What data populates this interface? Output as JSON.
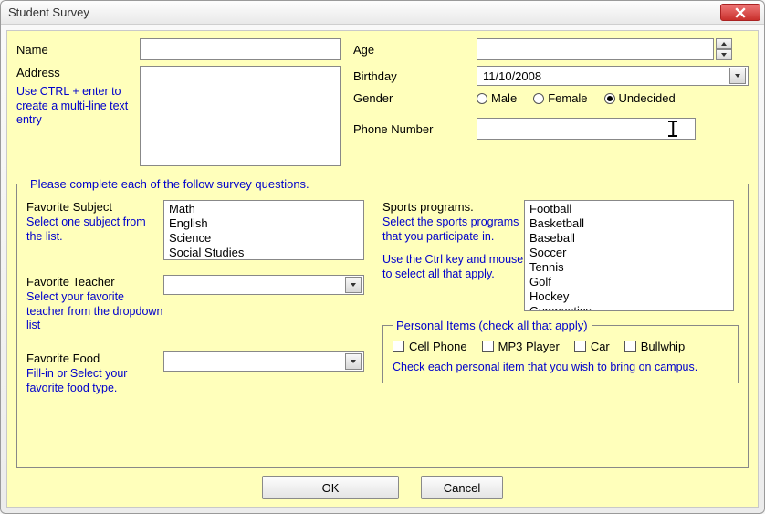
{
  "window": {
    "title": "Student Survey"
  },
  "top": {
    "name_label": "Name",
    "name_value": "",
    "address_label": "Address",
    "address_value": "",
    "address_hint": "Use CTRL + enter to create a multi-line text entry",
    "age_label": "Age",
    "age_value": "",
    "birthday_label": "Birthday",
    "birthday_value": "11/10/2008",
    "gender_label": "Gender",
    "gender_options": {
      "male": "Male",
      "female": "Female",
      "undecided": "Undecided"
    },
    "gender_selected": "undecided",
    "phone_label": "Phone Number",
    "phone_value": ""
  },
  "legend": "Please complete each of the follow survey questions.",
  "subject": {
    "label": "Favorite Subject",
    "hint": "Select one subject from the list.",
    "items": [
      "Math",
      "English",
      "Science",
      "Social Studies"
    ]
  },
  "teacher": {
    "label": "Favorite Teacher",
    "hint": "Select your favorite teacher from the dropdown list",
    "value": ""
  },
  "food": {
    "label": "Favorite Food",
    "hint": "Fill-in or Select your favorite food type.",
    "value": ""
  },
  "sports": {
    "label": "Sports programs.",
    "hint1": "Select the sports programs that you participate in.",
    "hint2": "Use the Ctrl key and mouse to select all that apply.",
    "items": [
      "Football",
      "Basketball",
      "Baseball",
      "Soccer",
      "Tennis",
      "Golf",
      "Hockey",
      "Gymnastics"
    ]
  },
  "personal": {
    "legend": "Personal Items (check all that apply)",
    "items": {
      "cell": "Cell Phone",
      "mp3": "MP3 Player",
      "car": "Car",
      "bullwhip": "Bullwhip"
    },
    "hint": "Check each personal item that you wish to bring on campus."
  },
  "buttons": {
    "ok": "OK",
    "cancel": "Cancel"
  }
}
